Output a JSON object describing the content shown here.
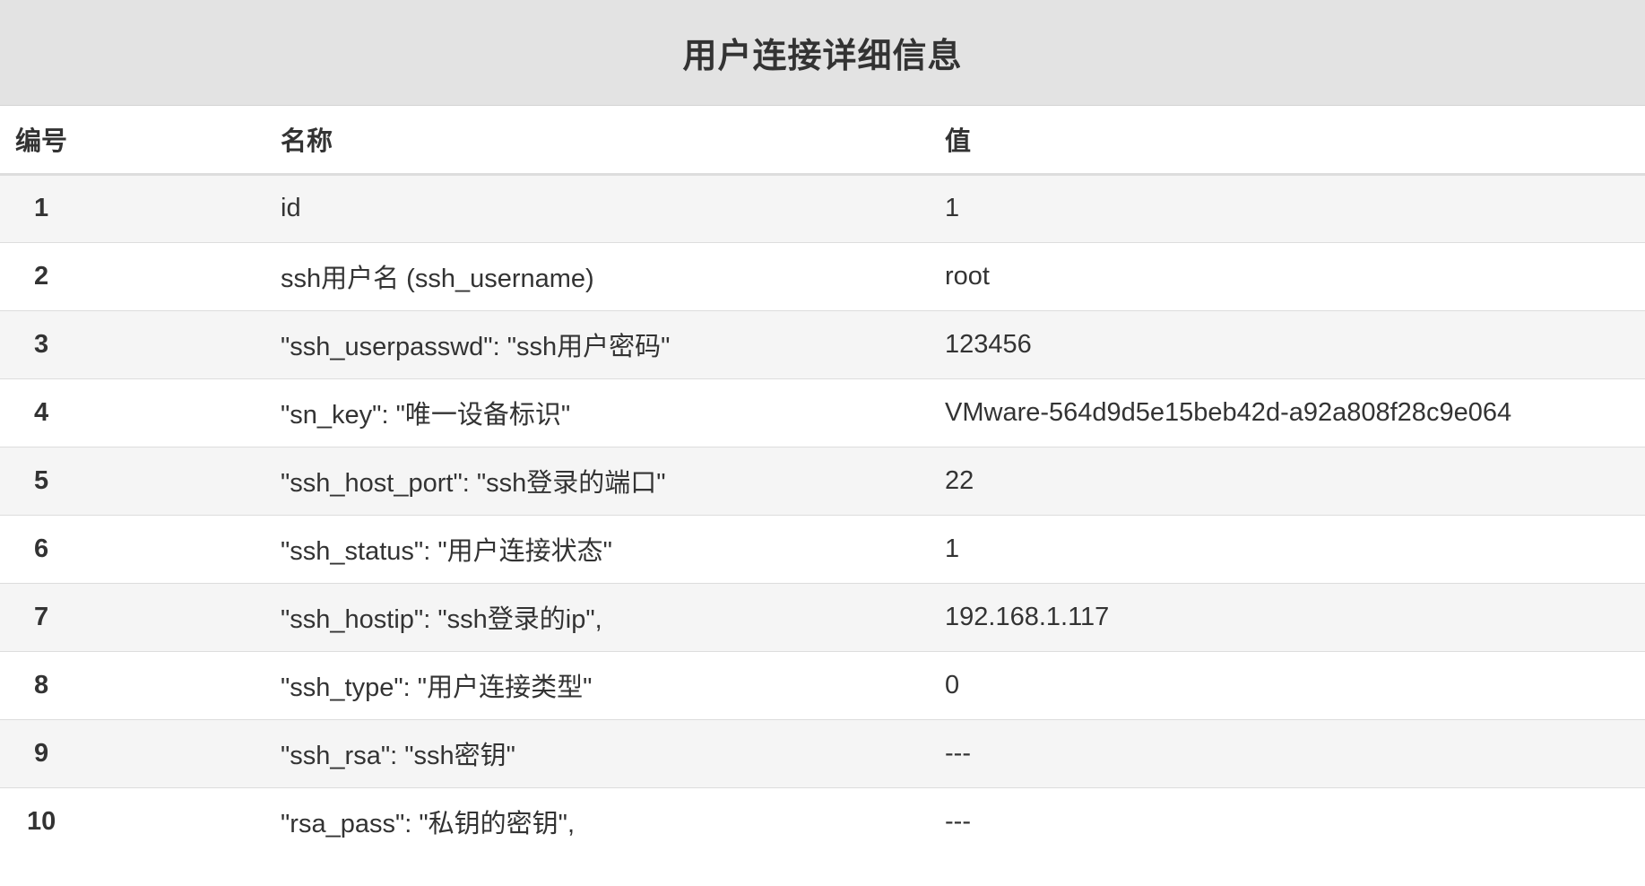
{
  "panel": {
    "title": "用户连接详细信息"
  },
  "table": {
    "headers": {
      "num": "编号",
      "name": "名称",
      "value": "值"
    },
    "rows": [
      {
        "num": "1",
        "name": "id",
        "value": "1"
      },
      {
        "num": "2",
        "name": "ssh用户名 (ssh_username)",
        "value": "root"
      },
      {
        "num": "3",
        "name": "\"ssh_userpasswd\": \"ssh用户密码\"",
        "value": "123456"
      },
      {
        "num": "4",
        "name": "\"sn_key\": \"唯一设备标识\"",
        "value": "VMware-564d9d5e15beb42d-a92a808f28c9e064"
      },
      {
        "num": "5",
        "name": "\"ssh_host_port\": \"ssh登录的端口\"",
        "value": "22"
      },
      {
        "num": "6",
        "name": "\"ssh_status\": \"用户连接状态\"",
        "value": "1"
      },
      {
        "num": "7",
        "name": "\"ssh_hostip\": \"ssh登录的ip\",",
        "value": "192.168.1.117"
      },
      {
        "num": "8",
        "name": "\"ssh_type\": \"用户连接类型\"",
        "value": "0"
      },
      {
        "num": "9",
        "name": "\"ssh_rsa\": \"ssh密钥\"",
        "value": "---"
      },
      {
        "num": "10",
        "name": "\"rsa_pass\": \"私钥的密钥\",",
        "value": "---"
      }
    ]
  }
}
